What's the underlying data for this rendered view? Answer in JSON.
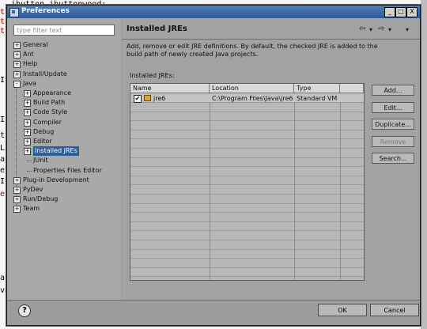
{
  "background_editor": {
    "lines": [
      {
        "text": "ibutton.ibuttonwood;",
        "red": false
      },
      {
        "text": "t",
        "red": true
      },
      {
        "text": "t",
        "red": true
      },
      {
        "text": "t",
        "red": true
      },
      {
        "text": "I",
        "red": false
      },
      {
        "text": "Ic",
        "red": false
      },
      {
        "text": "tt",
        "red": false
      },
      {
        "text": "L",
        "red": false
      },
      {
        "text": "au",
        "red": false
      },
      {
        "text": "et",
        "red": false
      },
      {
        "text": "Ic",
        "red": false
      },
      {
        "text": "e",
        "red": true
      },
      {
        "text": "av",
        "red": false
      },
      {
        "text": "va",
        "red": false
      }
    ],
    "right_fragment": ");"
  },
  "dialog": {
    "title": "Preferences",
    "window_buttons": [
      "_",
      "□",
      "X"
    ]
  },
  "filter": {
    "placeholder": "type filter text"
  },
  "tree": {
    "items": [
      {
        "label": "General",
        "expander": "+",
        "level": 0
      },
      {
        "label": "Ant",
        "expander": "+",
        "level": 0
      },
      {
        "label": "Help",
        "expander": "+",
        "level": 0
      },
      {
        "label": "Install/Update",
        "expander": "+",
        "level": 0
      },
      {
        "label": "Java",
        "expander": "-",
        "level": 0
      },
      {
        "label": "Appearance",
        "expander": "+",
        "level": 1
      },
      {
        "label": "Build Path",
        "expander": "+",
        "level": 1
      },
      {
        "label": "Code Style",
        "expander": "+",
        "level": 1
      },
      {
        "label": "Compiler",
        "expander": "+",
        "level": 1
      },
      {
        "label": "Debug",
        "expander": "+",
        "level": 1
      },
      {
        "label": "Editor",
        "expander": "+",
        "level": 1
      },
      {
        "label": "Installed JREs",
        "expander": "+",
        "level": 1,
        "selected": true
      },
      {
        "label": "JUnit",
        "expander": "",
        "level": 1
      },
      {
        "label": "Properties Files Editor",
        "expander": "",
        "level": 1
      },
      {
        "label": "Plug-in Development",
        "expander": "+",
        "level": 0
      },
      {
        "label": "PyDev",
        "expander": "+",
        "level": 0
      },
      {
        "label": "Run/Debug",
        "expander": "+",
        "level": 0
      },
      {
        "label": "Team",
        "expander": "+",
        "level": 0
      }
    ]
  },
  "page": {
    "title": "Installed JREs",
    "nav": {
      "back": "⇦",
      "back_menu": "▾",
      "forward": "⇨",
      "forward_menu": "▾",
      "view_menu": "▾"
    },
    "description": "Add, remove or edit JRE definitions. By default, the checked JRE is added to the build path of newly created Java projects.",
    "table_label": "Installed JREs:",
    "columns": [
      "Name",
      "Location",
      "Type"
    ],
    "rows": [
      {
        "checked": true,
        "name": "jre6",
        "location": "C:\\Program Files\\Java\\jre6",
        "type": "Standard VM"
      }
    ],
    "buttons": [
      {
        "label": "Add...",
        "enabled": true
      },
      {
        "label": "Edit...",
        "enabled": true
      },
      {
        "label": "Duplicate...",
        "enabled": true
      },
      {
        "label": "Remove",
        "enabled": false
      },
      {
        "label": "Search...",
        "enabled": true
      }
    ]
  },
  "footer": {
    "help": "?",
    "ok": "OK",
    "cancel": "Cancel"
  }
}
